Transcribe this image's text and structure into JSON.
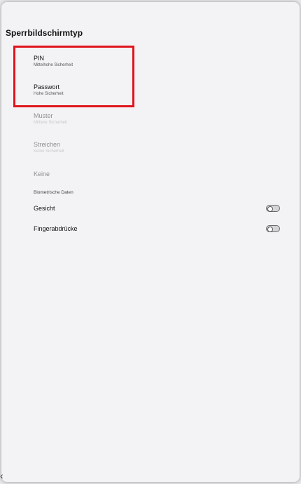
{
  "page_title": "Sperrbildschirmtyp",
  "options": [
    {
      "label": "PIN",
      "sub": "Mittelhohe Sicherheit"
    },
    {
      "label": "Passwort",
      "sub": "Hohe Sicherheit"
    },
    {
      "label": "Muster",
      "sub": "Mittlere Sicherheit"
    },
    {
      "label": "Streichen",
      "sub": "Keine Sicherheit"
    },
    {
      "label": "Keine",
      "sub": ""
    }
  ],
  "biometrics": {
    "section_title": "Biometrische Daten",
    "items": [
      {
        "label": "Gesicht",
        "enabled": false
      },
      {
        "label": "Fingerabdrücke",
        "enabled": false
      }
    ]
  },
  "colors": {
    "highlight": "#e0141e"
  },
  "back_icon": "chevron-left-icon"
}
